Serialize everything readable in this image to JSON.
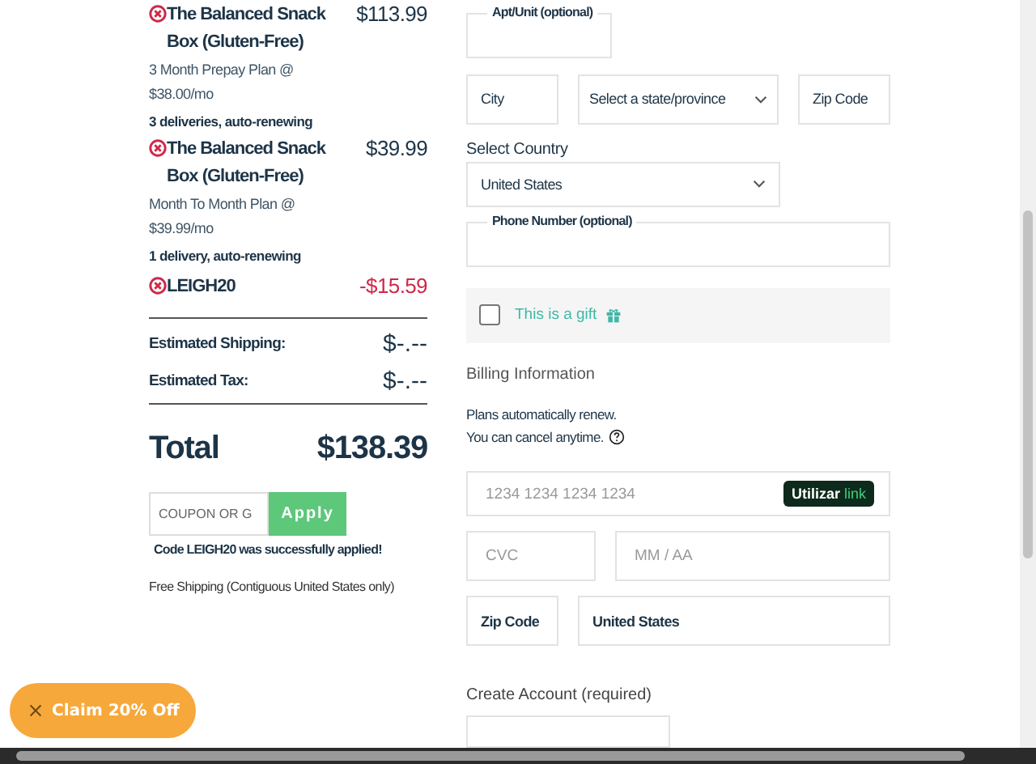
{
  "order_items": [
    {
      "title": "The Balanced Snack Box (Gluten-Free)",
      "price": "$113.99",
      "plan": "3 Month Prepay Plan @ $38.00/mo",
      "deliveries": "3 deliveries, auto-renewing"
    },
    {
      "title": "The Balanced Snack Box (Gluten-Free)",
      "price": "$39.99",
      "plan": "Month To Month Plan @ $39.99/mo",
      "deliveries": "1 delivery, auto-renewing"
    }
  ],
  "discount": {
    "code": "LEIGH20",
    "amount": "-$15.59"
  },
  "estimates": [
    {
      "label": "Estimated Shipping:",
      "value": "$-.--"
    },
    {
      "label": "Estimated Tax:",
      "value": "$-.--"
    }
  ],
  "total": {
    "label": "Total",
    "value": "$138.39"
  },
  "coupon": {
    "placeholder": "COUPON OR G",
    "button": "Apply"
  },
  "coupon_message": "Code LEIGH20 was successfully applied!",
  "shipping_note": "Free Shipping (Contiguous United States only)",
  "promo": {
    "label": "Claim 20% Off"
  },
  "address": {
    "apt_label": "Apt/Unit (optional)",
    "city_placeholder": "City",
    "state_placeholder": "Select a state/province",
    "zip_placeholder": "Zip Code",
    "country_label": "Select Country",
    "country": "United States",
    "phone_label": "Phone Number (optional)"
  },
  "gift": {
    "label": "This is a gift",
    "checked": false
  },
  "billing": {
    "heading": "Billing Information",
    "note_lines": [
      "Plans automatically renew.",
      "You can cancel anytime."
    ],
    "card_placeholder": "1234 1234 1234 1234",
    "link_button": {
      "prefix": "Utilizar",
      "brand": "link"
    },
    "cvc_placeholder": "CVC",
    "expiry_placeholder": "MM / AA",
    "zip": "Zip Code",
    "country": "United States"
  },
  "create_account": {
    "heading": "Create Account (required)"
  }
}
